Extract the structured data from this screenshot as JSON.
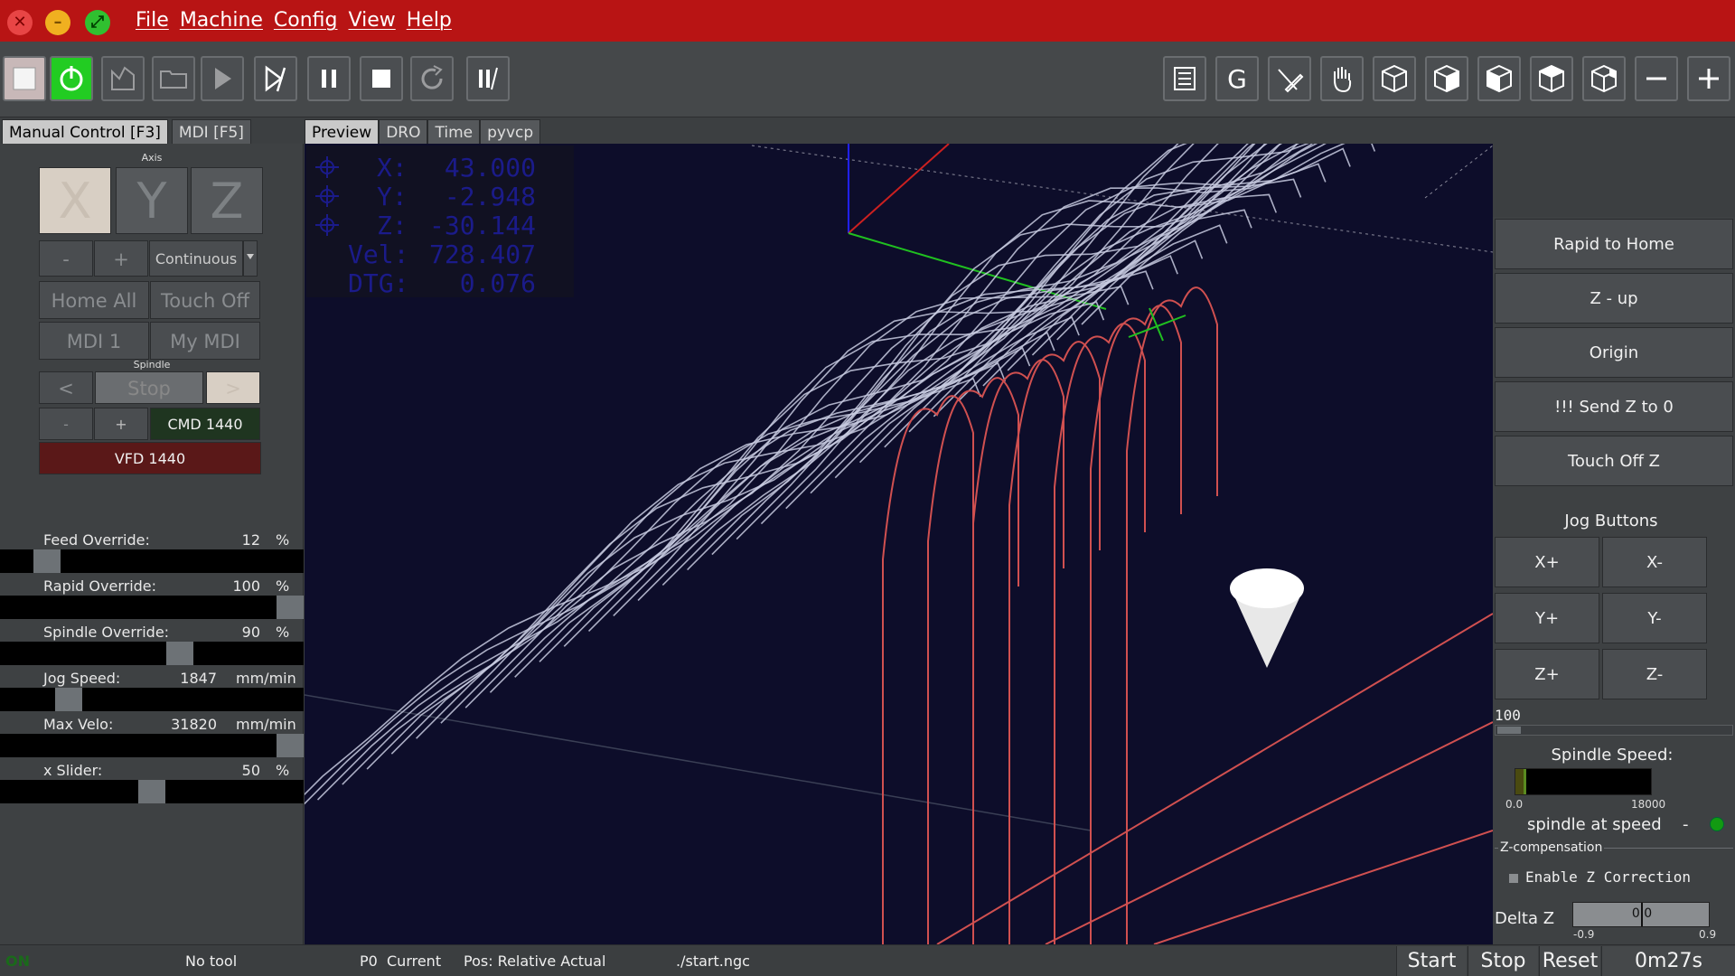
{
  "menu": [
    "File",
    "Machine",
    "Config",
    "View",
    "Help"
  ],
  "left_tabs": [
    "Manual Control [F3]",
    "MDI [F5]"
  ],
  "preview_tabs": [
    "Preview",
    "DRO",
    "Time",
    "pyvcp"
  ],
  "manual": {
    "axis_label": "Axis",
    "axes": [
      "X",
      "Y",
      "Z"
    ],
    "jog_minus": "-",
    "jog_plus": "+",
    "jog_mode": "Continuous",
    "home_all": "Home All",
    "touch_off": "Touch Off",
    "mdi1": "MDI 1",
    "my_mdi": "My MDI",
    "spindle_label": "Spindle",
    "spindle_ccw": "<",
    "spindle_stop": "Stop",
    "spindle_cw": ">",
    "speed_minus": "-",
    "speed_plus": "+",
    "cmd": "CMD 1440",
    "vfd": "VFD 1440"
  },
  "sliders": [
    {
      "label": "Feed Override:",
      "value": "12",
      "unit": "%",
      "fraction": 0.12
    },
    {
      "label": "Rapid Override:",
      "value": "100",
      "unit": "%",
      "fraction": 1.0
    },
    {
      "label": "Spindle Override:",
      "value": "90",
      "unit": "%",
      "fraction": 0.6
    },
    {
      "label": "Jog Speed:",
      "value": "1847",
      "unit": "mm/min",
      "fraction": 0.2
    },
    {
      "label": "Max Velo:",
      "value": "31820",
      "unit": "mm/min",
      "fraction": 1.0
    },
    {
      "label": "x Slider:",
      "value": "50",
      "unit": "%",
      "fraction": 0.5
    }
  ],
  "dro": [
    {
      "k": "X:",
      "v": "43.000"
    },
    {
      "k": "Y:",
      "v": "-2.948"
    },
    {
      "k": "Z:",
      "v": "-30.144"
    },
    {
      "k": "Vel:",
      "v": "728.407"
    },
    {
      "k": "DTG:",
      "v": "0.076"
    }
  ],
  "right": {
    "buttons": [
      "Rapid to Home",
      "Z - up",
      "Origin",
      "!!! Send Z to 0",
      "Touch Off Z"
    ],
    "jog_title": "Jog Buttons",
    "jog": [
      "X+",
      "X-",
      "Y+",
      "Y-",
      "Z+",
      "Z-"
    ],
    "jog_value": "100",
    "spindle_speed_title": "Spindle Speed:",
    "bar_min": "0.0",
    "bar_max": "18000",
    "bar_fraction": 0.08,
    "at_speed": "spindle at speed",
    "at_speed_dash": "-",
    "zcomp_title": "Z-compensation",
    "enable_z": "Enable Z Correction",
    "delta_z": "Delta Z",
    "delta_value": "0.0",
    "delta_min": "-0.9",
    "delta_max": "0.9"
  },
  "status": {
    "on": "ON",
    "tool": "No tool",
    "coord": "P0  Current",
    "pos": "Pos: Relative Actual",
    "file": "./start.ngc",
    "start": "Start",
    "stop": "Stop",
    "reset": "Reset",
    "time": "0m27s"
  },
  "colors": {
    "titlebar": "#b81414",
    "toolpath": "#c8cbe0",
    "toolpath_done": "#d05050",
    "background": "#0d0d2a"
  }
}
